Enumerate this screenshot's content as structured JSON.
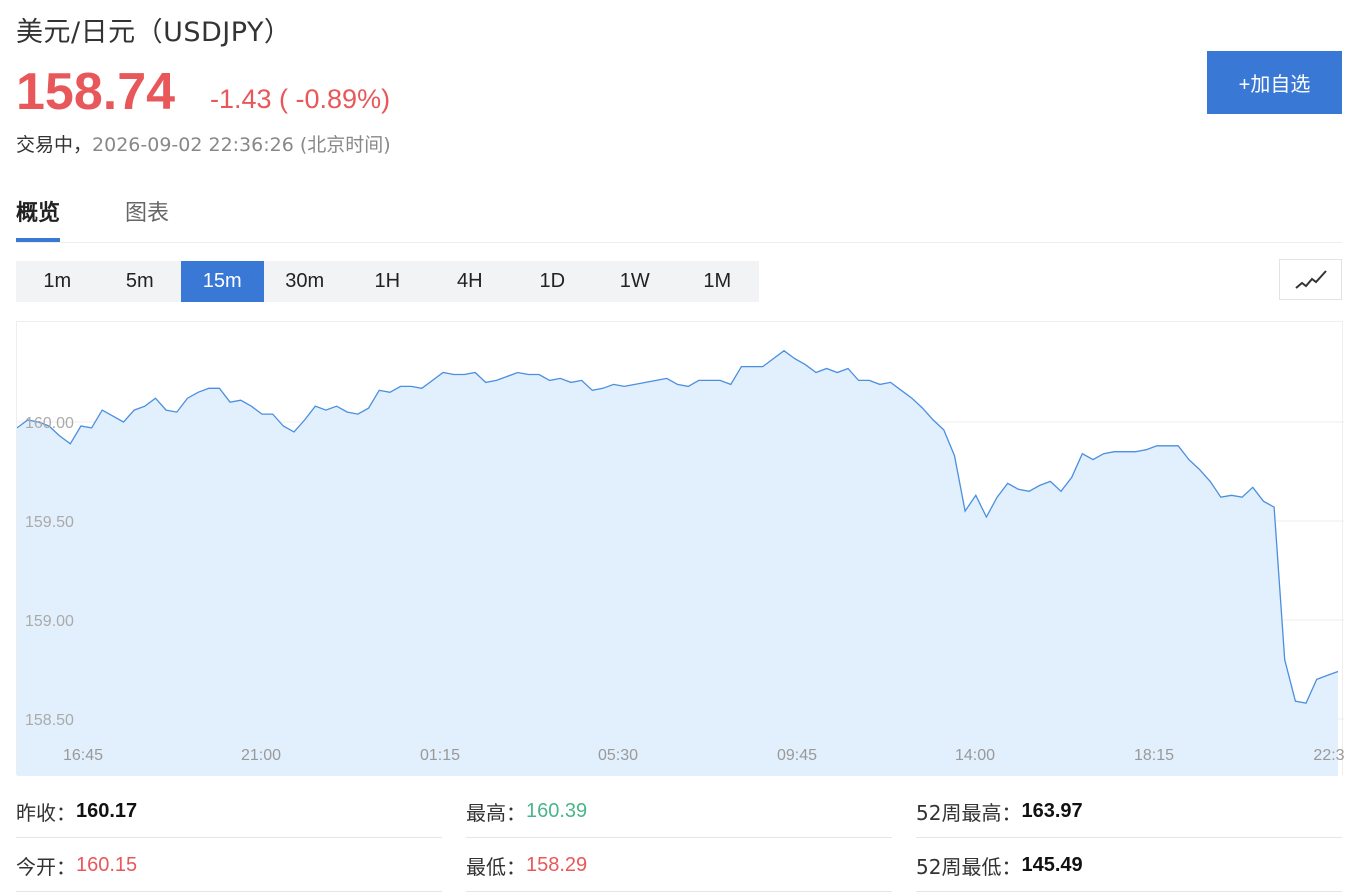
{
  "header": {
    "title": "美元/日元（USDJPY）",
    "price": "158.74",
    "change": "-1.43 ( -0.89%)",
    "status_label": "交易中，",
    "timestamp": "2026-09-02 22:36:26 (北京时间)",
    "add_button": "+加自选"
  },
  "tabs": [
    {
      "label": "概览",
      "active": true
    },
    {
      "label": "图表",
      "active": false
    }
  ],
  "periods": [
    {
      "label": "1m",
      "active": false
    },
    {
      "label": "5m",
      "active": false
    },
    {
      "label": "15m",
      "active": true
    },
    {
      "label": "30m",
      "active": false
    },
    {
      "label": "1H",
      "active": false
    },
    {
      "label": "4H",
      "active": false
    },
    {
      "label": "1D",
      "active": false
    },
    {
      "label": "1W",
      "active": false
    },
    {
      "label": "1M",
      "active": false
    }
  ],
  "chart_toggle_icon": "line-chart-icon",
  "colors": {
    "accent": "#3a78d6",
    "down": "#e8585a",
    "up": "#4bb58a",
    "line": "#4a8fe0",
    "area": "#e2effc"
  },
  "chart_data": {
    "type": "area",
    "x_ticks": [
      "16:45",
      "21:00",
      "01:15",
      "05:30",
      "09:45",
      "14:00",
      "18:15",
      "22:3"
    ],
    "y_ticks": [
      "160.00",
      "159.50",
      "159.00",
      "158.50"
    ],
    "ylim": [
      158.4,
      160.5
    ],
    "grid": true,
    "values": [
      159.97,
      160.01,
      160.0,
      159.98,
      159.93,
      159.89,
      159.98,
      159.97,
      160.06,
      160.03,
      160.0,
      160.06,
      160.08,
      160.12,
      160.06,
      160.05,
      160.12,
      160.15,
      160.17,
      160.17,
      160.1,
      160.11,
      160.08,
      160.04,
      160.04,
      159.98,
      159.95,
      160.01,
      160.08,
      160.06,
      160.08,
      160.05,
      160.04,
      160.07,
      160.16,
      160.15,
      160.18,
      160.18,
      160.17,
      160.21,
      160.25,
      160.24,
      160.24,
      160.25,
      160.2,
      160.21,
      160.23,
      160.25,
      160.24,
      160.24,
      160.21,
      160.22,
      160.2,
      160.21,
      160.16,
      160.17,
      160.19,
      160.18,
      160.19,
      160.2,
      160.21,
      160.22,
      160.19,
      160.18,
      160.21,
      160.21,
      160.21,
      160.19,
      160.28,
      160.28,
      160.28,
      160.32,
      160.36,
      160.32,
      160.29,
      160.25,
      160.27,
      160.25,
      160.27,
      160.21,
      160.21,
      160.19,
      160.2,
      160.16,
      160.12,
      160.07,
      160.01,
      159.96,
      159.83,
      159.55,
      159.63,
      159.52,
      159.62,
      159.69,
      159.66,
      159.65,
      159.68,
      159.7,
      159.65,
      159.72,
      159.84,
      159.81,
      159.84,
      159.85,
      159.85,
      159.85,
      159.86,
      159.88,
      159.88,
      159.88,
      159.81,
      159.76,
      159.7,
      159.62,
      159.63,
      159.62,
      159.67,
      159.6,
      159.57,
      158.8,
      158.59,
      158.58,
      158.7,
      158.72,
      158.74
    ]
  },
  "stats": [
    {
      "label": "昨收：",
      "value": "160.17",
      "color": "default"
    },
    {
      "label": "最高：",
      "value": "160.39",
      "color": "green"
    },
    {
      "label": "52周最高：",
      "value": "163.97",
      "color": "default"
    },
    {
      "label": "今开：",
      "value": "160.15",
      "color": "red"
    },
    {
      "label": "最低：",
      "value": "158.29",
      "color": "red"
    },
    {
      "label": "52周最低：",
      "value": "145.49",
      "color": "default"
    }
  ]
}
